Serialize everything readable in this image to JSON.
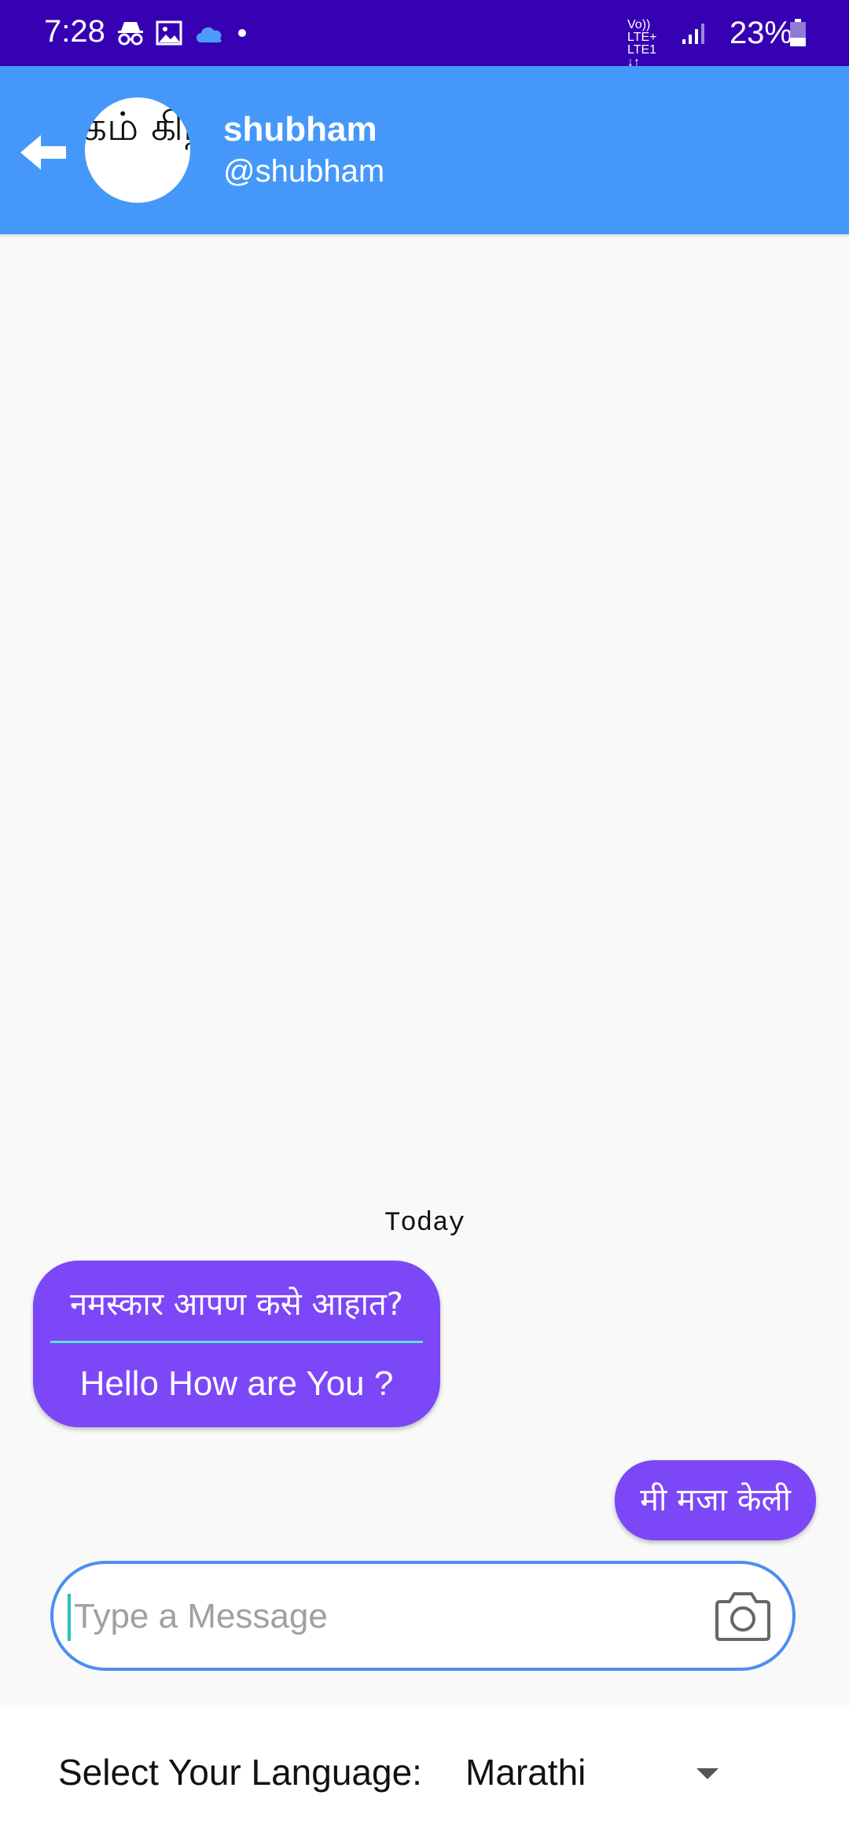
{
  "status_bar": {
    "time": "7:28",
    "network_line1": "Vo)) LTE+",
    "network_line2": "LTE1 ↓↑",
    "battery_percent": "23%",
    "icons": [
      "incognito-icon",
      "image-icon",
      "cloud-icon",
      "dot-icon",
      "signal-icon",
      "battery-icon"
    ]
  },
  "header": {
    "back_icon": "back-arrow-icon",
    "avatar_text": "கம் கிறா",
    "contact_name": "shubham",
    "contact_handle": "@shubham",
    "background_color": "#4598f9"
  },
  "chat": {
    "date_divider": "Today",
    "messages": [
      {
        "direction": "incoming",
        "original": "नमस्कार आपण कसे आहात?",
        "translation": "Hello How are You ?"
      },
      {
        "direction": "outgoing",
        "text": "मी मजा केली"
      }
    ],
    "bubble_color": "#7c47f7"
  },
  "composer": {
    "placeholder": "Type a Message",
    "value": "",
    "camera_icon": "camera-icon"
  },
  "language": {
    "label": "Select Your Language:",
    "selected": "Marathi"
  }
}
